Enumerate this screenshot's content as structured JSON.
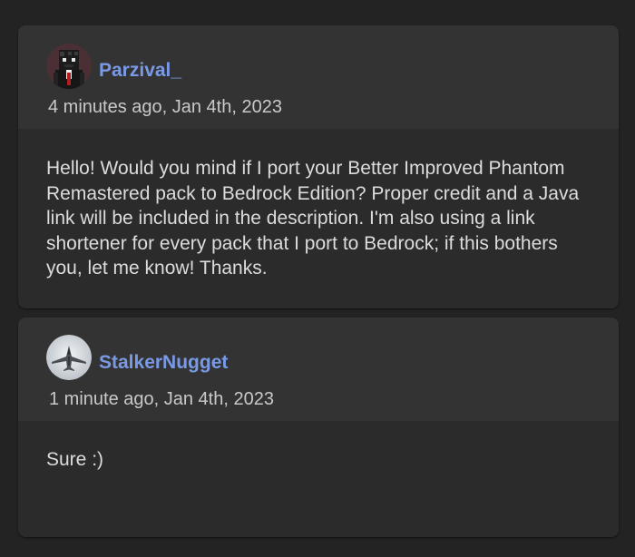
{
  "comments": [
    {
      "username": "Parzival_",
      "timestamp": "4 minutes ago, Jan 4th, 2023",
      "body": "Hello! Would you mind if I port your Better Improved Phantom Remastered pack to Bedrock Edition? Proper credit and a Java link will be included in the description. I'm also using a link shortener for every pack that I port to Bedrock; if this bothers you, let me know! Thanks.",
      "avatar_icon": "pixel-character-avatar"
    },
    {
      "username": "StalkerNugget",
      "timestamp": "1 minute ago, Jan 4th, 2023",
      "body": "Sure :)",
      "avatar_icon": "jet-fighter-avatar"
    }
  ],
  "colors": {
    "page_background": "#232323",
    "card_body": "#2b2b2b",
    "card_header": "#333333",
    "username": "#7a9ae6",
    "timestamp": "#c9c9c9",
    "body_text": "#dcdcdc"
  }
}
